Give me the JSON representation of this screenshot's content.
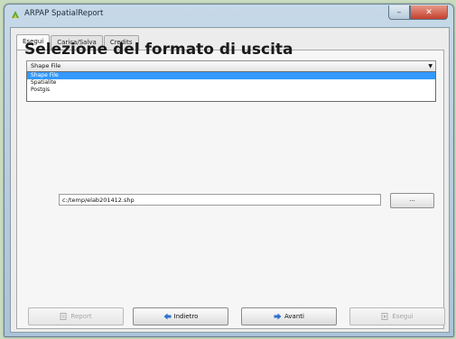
{
  "window": {
    "title": "ARPAP SpatialReport",
    "minimize_glyph": "–",
    "close_glyph": "✕"
  },
  "tabs": [
    {
      "label": "Esegui",
      "active": true
    },
    {
      "label": "Carica/Salva",
      "active": false
    },
    {
      "label": "Credits",
      "active": false
    }
  ],
  "main": {
    "heading": "Selezione del formato di uscita",
    "format_combo": {
      "selected": "Shape File",
      "options": [
        "Shape File",
        "Spatialite",
        "Postgis"
      ],
      "highlighted_index": 0
    },
    "output_path": "c:/temp/elab201412.shp",
    "browse_label": "..."
  },
  "buttons": {
    "report": {
      "label": "Report",
      "enabled": false,
      "icon": "report-icon"
    },
    "back": {
      "label": "Indietro",
      "enabled": true,
      "icon": "arrow-left-icon"
    },
    "next": {
      "label": "Avanti",
      "enabled": true,
      "icon": "arrow-right-icon"
    },
    "run": {
      "label": "Esegui",
      "enabled": false,
      "icon": "run-icon"
    }
  },
  "colors": {
    "selection": "#3399ff",
    "close_button": "#c4402c",
    "arrow_icon": "#2f6fcf"
  }
}
